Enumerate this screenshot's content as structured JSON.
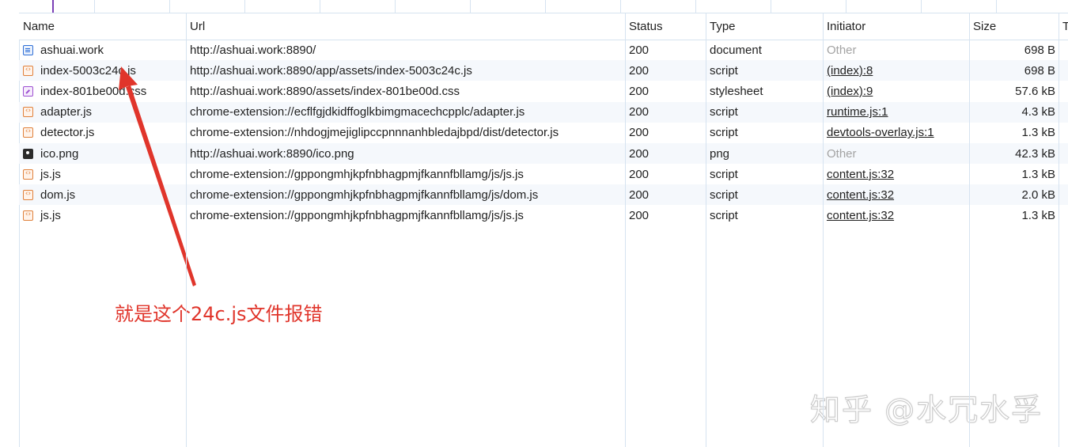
{
  "columns": {
    "name": "Name",
    "url": "Url",
    "status": "Status",
    "type": "Type",
    "initiator": "Initiator",
    "size": "Size",
    "time": "T"
  },
  "requests": [
    {
      "icon": "document-icon",
      "name": "ashuai.work",
      "url": "http://ashuai.work:8890/",
      "status": "200",
      "type": "document",
      "initiator": "Other",
      "initiator_link": false,
      "size": "698 B"
    },
    {
      "icon": "script-icon",
      "name": "index-5003c24c.js",
      "url": "http://ashuai.work:8890/app/assets/index-5003c24c.js",
      "status": "200",
      "type": "script",
      "initiator": "(index):8",
      "initiator_link": true,
      "size": "698 B"
    },
    {
      "icon": "stylesheet-icon",
      "name": "index-801be00d.css",
      "url": "http://ashuai.work:8890/assets/index-801be00d.css",
      "status": "200",
      "type": "stylesheet",
      "initiator": "(index):9",
      "initiator_link": true,
      "size": "57.6 kB"
    },
    {
      "icon": "script-icon",
      "name": "adapter.js",
      "url": "chrome-extension://ecflfgjdkidffoglkbimgmacechcpplc/adapter.js",
      "status": "200",
      "type": "script",
      "initiator": "runtime.js:1",
      "initiator_link": true,
      "size": "4.3 kB"
    },
    {
      "icon": "script-icon",
      "name": "detector.js",
      "url": "chrome-extension://nhdogjmejiglipccpnnnanhbledajbpd/dist/detector.js",
      "status": "200",
      "type": "script",
      "initiator": "devtools-overlay.js:1",
      "initiator_link": true,
      "size": "1.3 kB"
    },
    {
      "icon": "image-icon",
      "name": "ico.png",
      "url": "http://ashuai.work:8890/ico.png",
      "status": "200",
      "type": "png",
      "initiator": "Other",
      "initiator_link": false,
      "size": "42.3 kB"
    },
    {
      "icon": "script-icon",
      "name": "js.js",
      "url": "chrome-extension://gppongmhjkpfnbhagpmjfkannfbllamg/js/js.js",
      "status": "200",
      "type": "script",
      "initiator": "content.js:32",
      "initiator_link": true,
      "size": "1.3 kB"
    },
    {
      "icon": "script-icon",
      "name": "dom.js",
      "url": "chrome-extension://gppongmhjkpfnbhagpmjfkannfbllamg/js/dom.js",
      "status": "200",
      "type": "script",
      "initiator": "content.js:32",
      "initiator_link": true,
      "size": "2.0 kB"
    },
    {
      "icon": "script-icon",
      "name": "js.js",
      "url": "chrome-extension://gppongmhjkpfnbhagpmjfkannfbllamg/js/js.js",
      "status": "200",
      "type": "script",
      "initiator": "content.js:32",
      "initiator_link": true,
      "size": "1.3 kB"
    }
  ],
  "annotation": "就是这个24c.js文件报错",
  "watermark": "知乎 @水冗水孚",
  "colors": {
    "annotation": "#e0352b",
    "grid_line": "#d6e3f0",
    "row_alt": "#f5f8fc",
    "muted_text": "#a3a3a3"
  }
}
